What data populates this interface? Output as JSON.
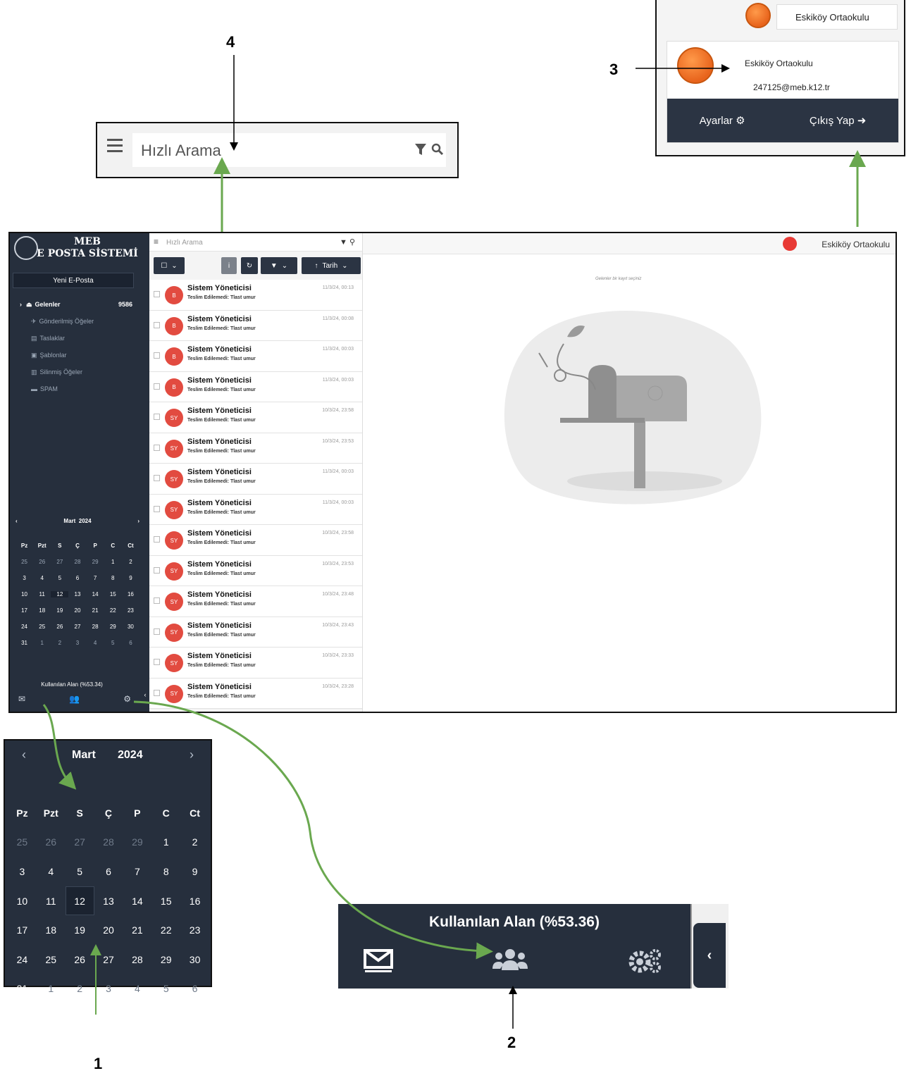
{
  "callouts": {
    "n1": "1",
    "n2": "2",
    "n3": "3",
    "n4": "4"
  },
  "search_zoom": {
    "placeholder": "Hızlı Arama"
  },
  "profile_zoom": {
    "top_name": "Eskiköy Ortaokulu",
    "card_name": "Eskiköy Ortaokulu",
    "card_email": "247125@meb.k12.tr",
    "settings_label": "Ayarlar",
    "logout_label": "Çıkış Yap"
  },
  "app": {
    "logo_line1": "MEB",
    "logo_line2": "E POSTA SİSTEMİ",
    "new_mail_label": "Yeni E-Posta",
    "folders": [
      {
        "label": "Gelenler",
        "count": "9586"
      },
      {
        "label": "Gönderilmiş Öğeler"
      },
      {
        "label": "Taslaklar"
      },
      {
        "label": "Şablonlar"
      },
      {
        "label": "Silinmiş Öğeler"
      },
      {
        "label": "SPAM"
      }
    ],
    "search_placeholder": "Hızlı Arama",
    "sort_label": "Tarih",
    "user_name": "Eskiköy Ortaokulu",
    "reading_hint": "Gelenler bir kayıt seçiniz",
    "usage_label": "Kullanılan Alan (%53.34)",
    "emails": [
      {
        "avatar": "B",
        "sender": "Sistem Yöneticisi",
        "subject": "Teslim Edilemedi: Tlast umur",
        "time": "11/3/24, 00:13"
      },
      {
        "avatar": "B",
        "sender": "Sistem Yöneticisi",
        "subject": "Teslim Edilemedi: Tlast umur",
        "time": "11/3/24, 00:08"
      },
      {
        "avatar": "B",
        "sender": "Sistem Yöneticisi",
        "subject": "Teslim Edilemedi: Tlast umur",
        "time": "11/3/24, 00:03"
      },
      {
        "avatar": "B",
        "sender": "Sistem Yöneticisi",
        "subject": "Teslim Edilemedi: Tlast umur",
        "time": "11/3/24, 00:03"
      },
      {
        "avatar": "SY",
        "sender": "Sistem Yöneticisi",
        "subject": "Teslim Edilemedi: Tlast umur",
        "time": "10/3/24, 23:58"
      },
      {
        "avatar": "SY",
        "sender": "Sistem Yöneticisi",
        "subject": "Teslim Edilemedi: Tlast umur",
        "time": "10/3/24, 23:53"
      },
      {
        "avatar": "SY",
        "sender": "Sistem Yöneticisi",
        "subject": "Teslim Edilemedi: Tlast umur",
        "time": "11/3/24, 00:03"
      },
      {
        "avatar": "SY",
        "sender": "Sistem Yöneticisi",
        "subject": "Teslim Edilemedi: Tlast umur",
        "time": "11/3/24, 00:03"
      },
      {
        "avatar": "SY",
        "sender": "Sistem Yöneticisi",
        "subject": "Teslim Edilemedi: Tlast umur",
        "time": "10/3/24, 23:58"
      },
      {
        "avatar": "SY",
        "sender": "Sistem Yöneticisi",
        "subject": "Teslim Edilemedi: Tlast umur",
        "time": "10/3/24, 23:53"
      },
      {
        "avatar": "SY",
        "sender": "Sistem Yöneticisi",
        "subject": "Teslim Edilemedi: Tlast umur",
        "time": "10/3/24, 23:48"
      },
      {
        "avatar": "SY",
        "sender": "Sistem Yöneticisi",
        "subject": "Teslim Edilemedi: Tlast umur",
        "time": "10/3/24, 23:43"
      },
      {
        "avatar": "SY",
        "sender": "Sistem Yöneticisi",
        "subject": "Teslim Edilemedi: Tlast umur",
        "time": "10/3/24, 23:33"
      },
      {
        "avatar": "SY",
        "sender": "Sistem Yöneticisi",
        "subject": "Teslim Edilemedi: Tlast umur",
        "time": "10/3/24, 23:28"
      }
    ]
  },
  "calendar": {
    "month": "Mart",
    "year": "2024",
    "weekdays": [
      "Pz",
      "Pzt",
      "S",
      "Ç",
      "P",
      "C",
      "Ct"
    ],
    "days": [
      "25",
      "26",
      "27",
      "28",
      "29",
      "1",
      "2",
      "3",
      "4",
      "5",
      "6",
      "7",
      "8",
      "9",
      "10",
      "11",
      "12",
      "13",
      "14",
      "15",
      "16",
      "17",
      "18",
      "19",
      "20",
      "21",
      "22",
      "23",
      "24",
      "25",
      "26",
      "27",
      "28",
      "29",
      "30",
      "31",
      "1",
      "2",
      "3",
      "4",
      "5",
      "6"
    ],
    "current_month_start": 5,
    "current_month_end": 35,
    "selected_index": 16
  },
  "footer_zoom": {
    "usage_label": "Kullanılan Alan (%53.36)"
  },
  "colors": {
    "sidebar": "#262f3d",
    "accent_green": "#6aa84f",
    "avatar_red": "#e24b40",
    "orb_orange": "#e8641c"
  }
}
